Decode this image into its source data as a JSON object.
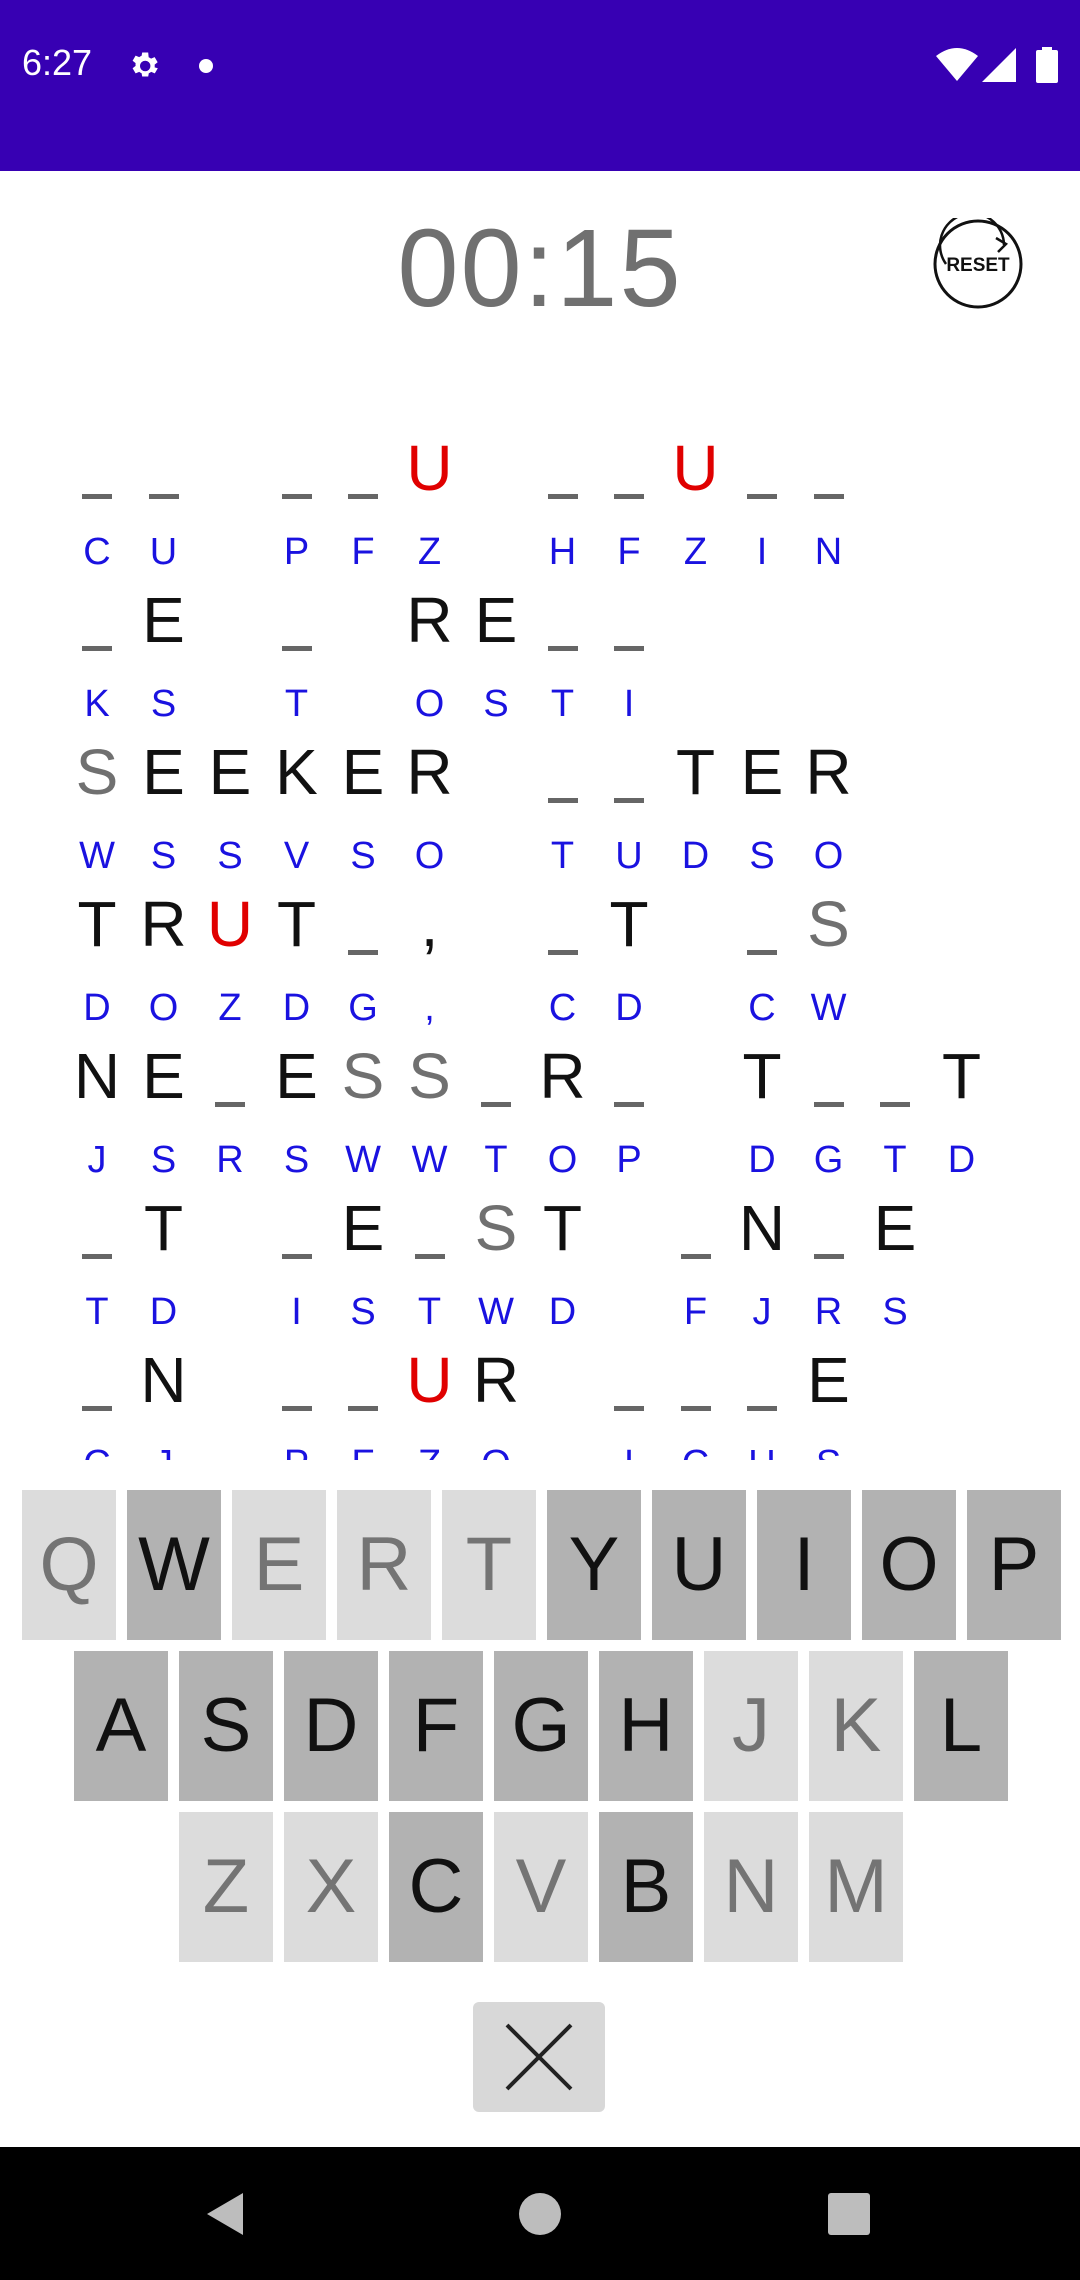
{
  "status_bar": {
    "time": "6:27"
  },
  "timer": "00:15",
  "reset_label": "RESET",
  "colors": {
    "status_bar": "#3700b3",
    "code_letter": "#1a12e0",
    "error_letter": "#e00000",
    "hint_letter": "#707070"
  },
  "puzzle": {
    "rows": [
      [
        {
          "col": 0,
          "top": "",
          "code": "C",
          "s": "blank"
        },
        {
          "col": 1,
          "top": "",
          "code": "U",
          "s": "blank"
        },
        {
          "col": 3,
          "top": "",
          "code": "P",
          "s": "blank"
        },
        {
          "col": 4,
          "top": "",
          "code": "F",
          "s": "blank"
        },
        {
          "col": 5,
          "top": "U",
          "code": "Z",
          "s": "red"
        },
        {
          "col": 7,
          "top": "",
          "code": "H",
          "s": "blank"
        },
        {
          "col": 8,
          "top": "",
          "code": "F",
          "s": "blank"
        },
        {
          "col": 9,
          "top": "U",
          "code": "Z",
          "s": "red"
        },
        {
          "col": 10,
          "top": "",
          "code": "I",
          "s": "blank"
        },
        {
          "col": 11,
          "top": "",
          "code": "N",
          "s": "blank"
        }
      ],
      [
        {
          "col": 0,
          "top": "",
          "code": "K",
          "s": "blank"
        },
        {
          "col": 1,
          "top": "E",
          "code": "S",
          "s": "black"
        },
        {
          "col": 3,
          "top": "",
          "code": "T",
          "s": "blank"
        },
        {
          "col": 5,
          "top": "R",
          "code": "O",
          "s": "black"
        },
        {
          "col": 6,
          "top": "E",
          "code": "S",
          "s": "black"
        },
        {
          "col": 7,
          "top": "",
          "code": "T",
          "s": "blank"
        },
        {
          "col": 8,
          "top": "",
          "code": "I",
          "s": "blank"
        }
      ],
      [
        {
          "col": 0,
          "top": "S",
          "code": "W",
          "s": "gray"
        },
        {
          "col": 1,
          "top": "E",
          "code": "S",
          "s": "black"
        },
        {
          "col": 2,
          "top": "E",
          "code": "S",
          "s": "black"
        },
        {
          "col": 3,
          "top": "K",
          "code": "V",
          "s": "black"
        },
        {
          "col": 4,
          "top": "E",
          "code": "S",
          "s": "black"
        },
        {
          "col": 5,
          "top": "R",
          "code": "O",
          "s": "black"
        },
        {
          "col": 7,
          "top": "",
          "code": "T",
          "s": "blank"
        },
        {
          "col": 8,
          "top": "",
          "code": "U",
          "s": "blank"
        },
        {
          "col": 9,
          "top": "T",
          "code": "D",
          "s": "black"
        },
        {
          "col": 10,
          "top": "E",
          "code": "S",
          "s": "black"
        },
        {
          "col": 11,
          "top": "R",
          "code": "O",
          "s": "black"
        }
      ],
      [
        {
          "col": 0,
          "top": "T",
          "code": "D",
          "s": "black"
        },
        {
          "col": 1,
          "top": "R",
          "code": "O",
          "s": "black"
        },
        {
          "col": 2,
          "top": "U",
          "code": "Z",
          "s": "red"
        },
        {
          "col": 3,
          "top": "T",
          "code": "D",
          "s": "black"
        },
        {
          "col": 4,
          "top": "",
          "code": "G",
          "s": "blank"
        },
        {
          "col": 5,
          "top": ",",
          "code": ",",
          "s": "black"
        },
        {
          "col": 7,
          "top": "",
          "code": "C",
          "s": "blank"
        },
        {
          "col": 8,
          "top": "T",
          "code": "D",
          "s": "black"
        },
        {
          "col": 10,
          "top": "",
          "code": "C",
          "s": "blank"
        },
        {
          "col": 11,
          "top": "S",
          "code": "W",
          "s": "gray"
        }
      ],
      [
        {
          "col": 0,
          "top": "N",
          "code": "J",
          "s": "black"
        },
        {
          "col": 1,
          "top": "E",
          "code": "S",
          "s": "black"
        },
        {
          "col": 2,
          "top": "",
          "code": "R",
          "s": "blank"
        },
        {
          "col": 3,
          "top": "E",
          "code": "S",
          "s": "black"
        },
        {
          "col": 4,
          "top": "S",
          "code": "W",
          "s": "gray"
        },
        {
          "col": 5,
          "top": "S",
          "code": "W",
          "s": "gray"
        },
        {
          "col": 6,
          "top": "",
          "code": "T",
          "s": "blank"
        },
        {
          "col": 7,
          "top": "R",
          "code": "O",
          "s": "black"
        },
        {
          "col": 8,
          "top": "",
          "code": "P",
          "s": "blank"
        },
        {
          "col": 10,
          "top": "T",
          "code": "D",
          "s": "black"
        },
        {
          "col": 11,
          "top": "",
          "code": "G",
          "s": "blank"
        },
        {
          "col": 12,
          "top": "",
          "code": "T",
          "s": "blank"
        },
        {
          "col": 13,
          "top": "T",
          "code": "D",
          "s": "black"
        }
      ],
      [
        {
          "col": 0,
          "top": "",
          "code": "T",
          "s": "blank"
        },
        {
          "col": 1,
          "top": "T",
          "code": "D",
          "s": "black"
        },
        {
          "col": 3,
          "top": "",
          "code": "I",
          "s": "blank"
        },
        {
          "col": 4,
          "top": "E",
          "code": "S",
          "s": "black"
        },
        {
          "col": 5,
          "top": "",
          "code": "T",
          "s": "blank"
        },
        {
          "col": 6,
          "top": "S",
          "code": "W",
          "s": "gray"
        },
        {
          "col": 7,
          "top": "T",
          "code": "D",
          "s": "black"
        },
        {
          "col": 9,
          "top": "",
          "code": "F",
          "s": "blank"
        },
        {
          "col": 10,
          "top": "N",
          "code": "J",
          "s": "black"
        },
        {
          "col": 11,
          "top": "",
          "code": "R",
          "s": "blank"
        },
        {
          "col": 12,
          "top": "E",
          "code": "S",
          "s": "black"
        }
      ],
      [
        {
          "col": 0,
          "top": "",
          "code": "C",
          "s": "blank"
        },
        {
          "col": 1,
          "top": "N",
          "code": "J",
          "s": "black"
        },
        {
          "col": 3,
          "top": "",
          "code": "P",
          "s": "blank"
        },
        {
          "col": 4,
          "top": "",
          "code": "F",
          "s": "blank"
        },
        {
          "col": 5,
          "top": "U",
          "code": "Z",
          "s": "red"
        },
        {
          "col": 6,
          "top": "R",
          "code": "O",
          "s": "black"
        },
        {
          "col": 8,
          "top": "",
          "code": "I",
          "s": "blank"
        },
        {
          "col": 9,
          "top": "",
          "code": "C",
          "s": "blank"
        },
        {
          "col": 10,
          "top": "",
          "code": "U",
          "s": "blank"
        },
        {
          "col": 11,
          "top": "E",
          "code": "S",
          "s": "black"
        }
      ]
    ]
  },
  "keyboard": {
    "rows": [
      [
        {
          "k": "Q",
          "used": true
        },
        {
          "k": "W",
          "used": false
        },
        {
          "k": "E",
          "used": true
        },
        {
          "k": "R",
          "used": true
        },
        {
          "k": "T",
          "used": true
        },
        {
          "k": "Y",
          "used": false
        },
        {
          "k": "U",
          "used": false
        },
        {
          "k": "I",
          "used": false
        },
        {
          "k": "O",
          "used": false
        },
        {
          "k": "P",
          "used": false
        }
      ],
      [
        {
          "k": "A",
          "used": false
        },
        {
          "k": "S",
          "used": false
        },
        {
          "k": "D",
          "used": false
        },
        {
          "k": "F",
          "used": false
        },
        {
          "k": "G",
          "used": false
        },
        {
          "k": "H",
          "used": false
        },
        {
          "k": "J",
          "used": true
        },
        {
          "k": "K",
          "used": true
        },
        {
          "k": "L",
          "used": false
        }
      ],
      [
        {
          "k": "Z",
          "used": true
        },
        {
          "k": "X",
          "used": true
        },
        {
          "k": "C",
          "used": false
        },
        {
          "k": "V",
          "used": true
        },
        {
          "k": "B",
          "used": false
        },
        {
          "k": "N",
          "used": true
        },
        {
          "k": "M",
          "used": true
        }
      ]
    ],
    "delete_icon": "close-icon"
  },
  "nav_bar": {
    "icons": [
      "back-icon",
      "home-icon",
      "recents-icon"
    ]
  }
}
